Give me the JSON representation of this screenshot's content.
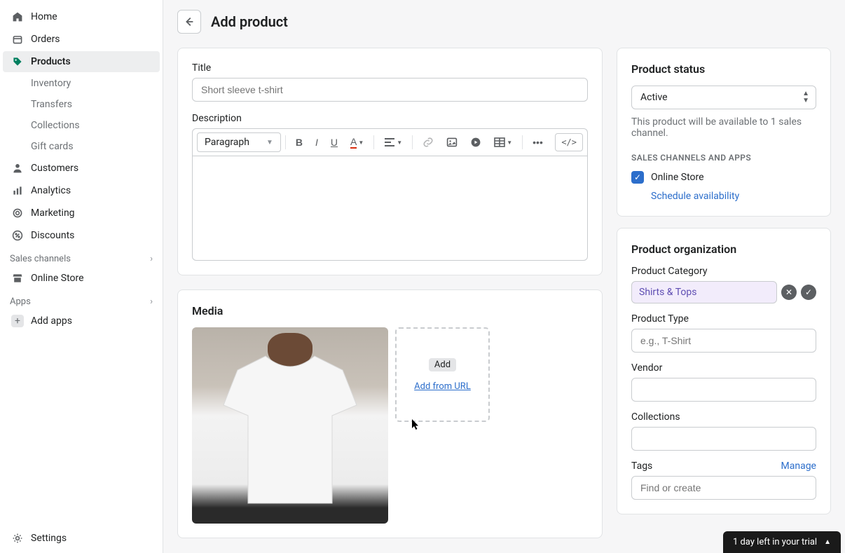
{
  "sidebar": {
    "items": [
      {
        "label": "Home"
      },
      {
        "label": "Orders"
      },
      {
        "label": "Products"
      },
      {
        "label": "Inventory"
      },
      {
        "label": "Transfers"
      },
      {
        "label": "Collections"
      },
      {
        "label": "Gift cards"
      },
      {
        "label": "Customers"
      },
      {
        "label": "Analytics"
      },
      {
        "label": "Marketing"
      },
      {
        "label": "Discounts"
      }
    ],
    "sales_channels_label": "Sales channels",
    "online_store_label": "Online Store",
    "apps_label": "Apps",
    "add_apps_label": "Add apps",
    "settings_label": "Settings"
  },
  "header": {
    "title": "Add product"
  },
  "title_card": {
    "label": "Title",
    "placeholder": "Short sleeve t-shirt",
    "desc_label": "Description",
    "format_label": "Paragraph"
  },
  "media": {
    "heading": "Media",
    "add_label": "Add",
    "add_url_label": "Add from URL"
  },
  "status": {
    "heading": "Product status",
    "value": "Active",
    "helper": "This product will be available to 1 sales channel.",
    "channels_heading": "SALES CHANNELS AND APPS",
    "channel_label": "Online Store",
    "schedule_label": "Schedule availability"
  },
  "org": {
    "heading": "Product organization",
    "cat_label": "Product Category",
    "cat_value": "Shirts & Tops",
    "type_label": "Product Type",
    "type_placeholder": "e.g., T-Shirt",
    "vendor_label": "Vendor",
    "collections_label": "Collections",
    "tags_label": "Tags",
    "manage_label": "Manage",
    "tags_placeholder": "Find or create"
  },
  "trial": {
    "text": "1 day left in your trial"
  }
}
